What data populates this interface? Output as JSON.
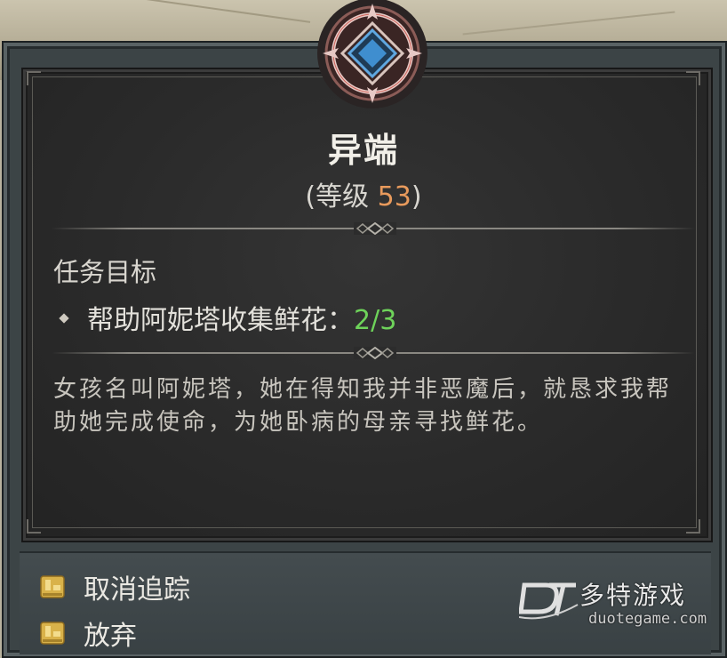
{
  "quest": {
    "title": "异端",
    "level_prefix": "(等级 ",
    "level_value": "53",
    "level_suffix": ")",
    "objective_header": "任务目标",
    "objective_text": "帮助阿妮塔收集鲜花：",
    "objective_progress": "2/3",
    "description": "女孩名叫阿妮塔，她在得知我并非恶魔后，就恳求我帮助她完成使命，为她卧病的母亲寻找鲜花。"
  },
  "actions": {
    "untrack_label": "取消追踪",
    "abandon_label": "放弃"
  },
  "watermark": {
    "brand": "多特游戏",
    "url": "duotegame.com"
  },
  "colors": {
    "level_number": "#e89a5c",
    "progress": "#6ed35a",
    "emblem_ring": "#e7c9c5",
    "emblem_core": "#3f8ecf",
    "key_icon": "#d9b24a"
  },
  "icons": {
    "quest_emblem": "quest-emblem-icon",
    "bullet": "diamond-bullet-icon",
    "action_key": "key-prompt-icon"
  }
}
